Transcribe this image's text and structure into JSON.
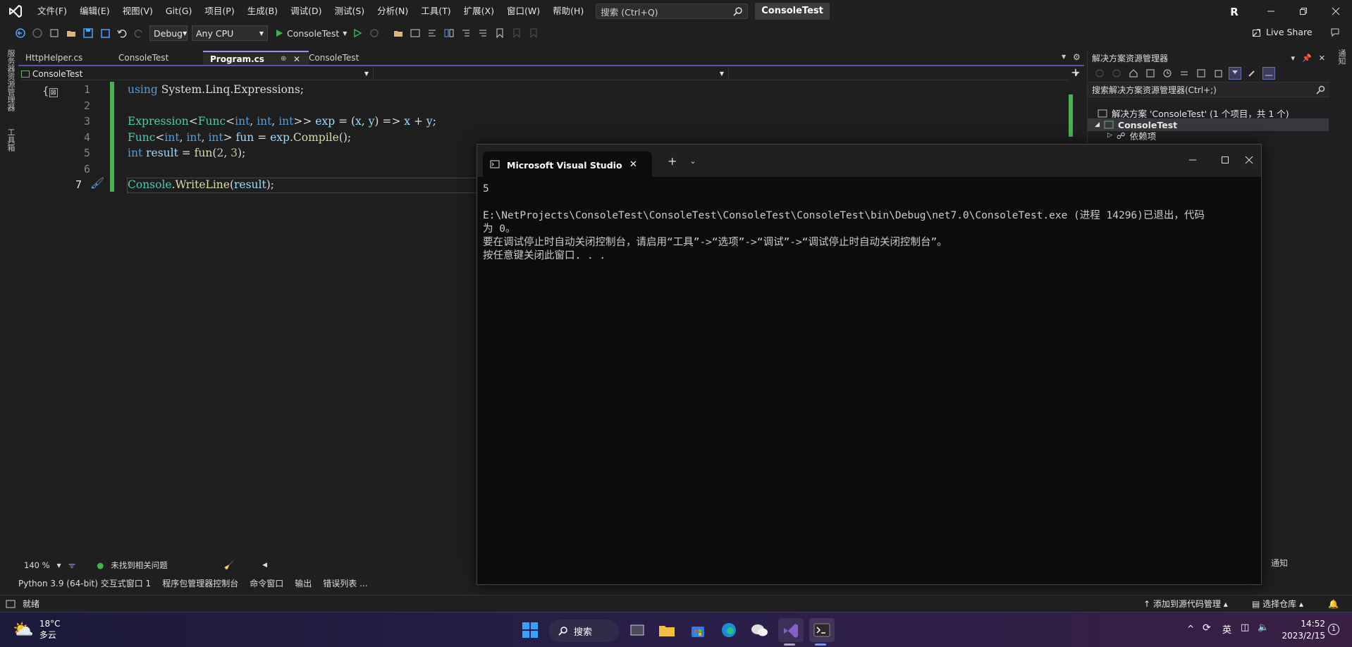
{
  "menu": [
    "文件(F)",
    "编辑(E)",
    "视图(V)",
    "Git(G)",
    "项目(P)",
    "生成(B)",
    "调试(D)",
    "测试(S)",
    "分析(N)",
    "工具(T)",
    "扩展(X)",
    "窗口(W)",
    "帮助(H)"
  ],
  "search": {
    "placeholder": "搜索 (Ctrl+Q)"
  },
  "solution_title": "ConsoleTest",
  "user_initial": "R",
  "toolbar": {
    "config": "Debug",
    "platform": "Any CPU",
    "start_label": "ConsoleTest",
    "live_share": "Live Share"
  },
  "siderail": {
    "item1": "服务器资源管理器",
    "item2": "工具箱"
  },
  "tabs": [
    "HttpHelper.cs",
    "ConsoleTest",
    "Program.cs",
    "ConsoleTest"
  ],
  "navbar": {
    "project": "ConsoleTest"
  },
  "editor": {
    "line_numbers": [
      "1",
      "2",
      "3",
      "4",
      "5",
      "6",
      "7"
    ],
    "zoom": "140 %",
    "issues": "未找到相关问题"
  },
  "bottom_tabs": [
    "Python 3.9 (64-bit) 交互式窗口 1",
    "程序包管理器控制台",
    "命令窗口",
    "输出",
    "错误列表 ..."
  ],
  "statusbar": {
    "ready": "就绪",
    "source_control": "添加到源代码管理",
    "repo": "选择仓库",
    "notify": "通知"
  },
  "solution_explorer": {
    "header": "解决方案资源管理器",
    "search": "搜索解决方案资源管理器(Ctrl+;)",
    "solution": "解决方案 'ConsoleTest' (1 个项目，共 1 个)",
    "project": "ConsoleTest",
    "deps": "依赖项"
  },
  "console": {
    "title": "Microsoft Visual Studio 调试控",
    "lines": [
      "5",
      "",
      "E:\\NetProjects\\ConsoleTest\\ConsoleTest\\ConsoleTest\\ConsoleTest\\bin\\Debug\\net7.0\\ConsoleTest.exe (进程 14296)已退出，代码",
      "为 0。",
      "要在调试停止时自动关闭控制台，请启用“工具”->“选项”->“调试”->“调试停止时自动关闭控制台”。",
      "按任意键关闭此窗口. . ."
    ]
  },
  "taskbar": {
    "temp": "18°C",
    "weather": "多云",
    "search": "搜索",
    "ime": "英",
    "time": "14:52",
    "date": "2023/2/15",
    "notif_count": "1"
  }
}
